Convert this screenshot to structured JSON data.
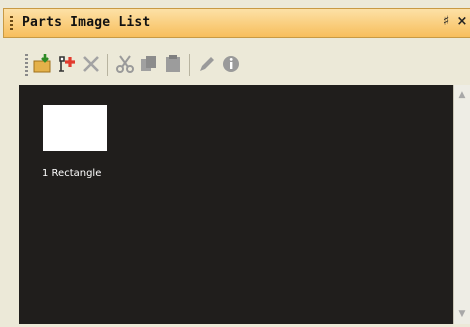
{
  "window": {
    "title": "Parts Image List",
    "pin_glyph": "♯",
    "close_glyph": "×"
  },
  "toolbar": {
    "tools": [
      {
        "name": "add-image-icon"
      },
      {
        "name": "add-part-icon"
      },
      {
        "name": "delete-icon"
      },
      {
        "name": "cut-icon"
      },
      {
        "name": "copy-icon"
      },
      {
        "name": "paste-icon"
      },
      {
        "name": "edit-icon"
      },
      {
        "name": "info-icon"
      }
    ]
  },
  "parts": [
    {
      "label": "1 Rectangle"
    }
  ],
  "colors": {
    "canvas": "#201e1c",
    "title_bar": "#f7be5c",
    "accent_green": "#3da62f",
    "accent_red": "#e23b2e"
  }
}
